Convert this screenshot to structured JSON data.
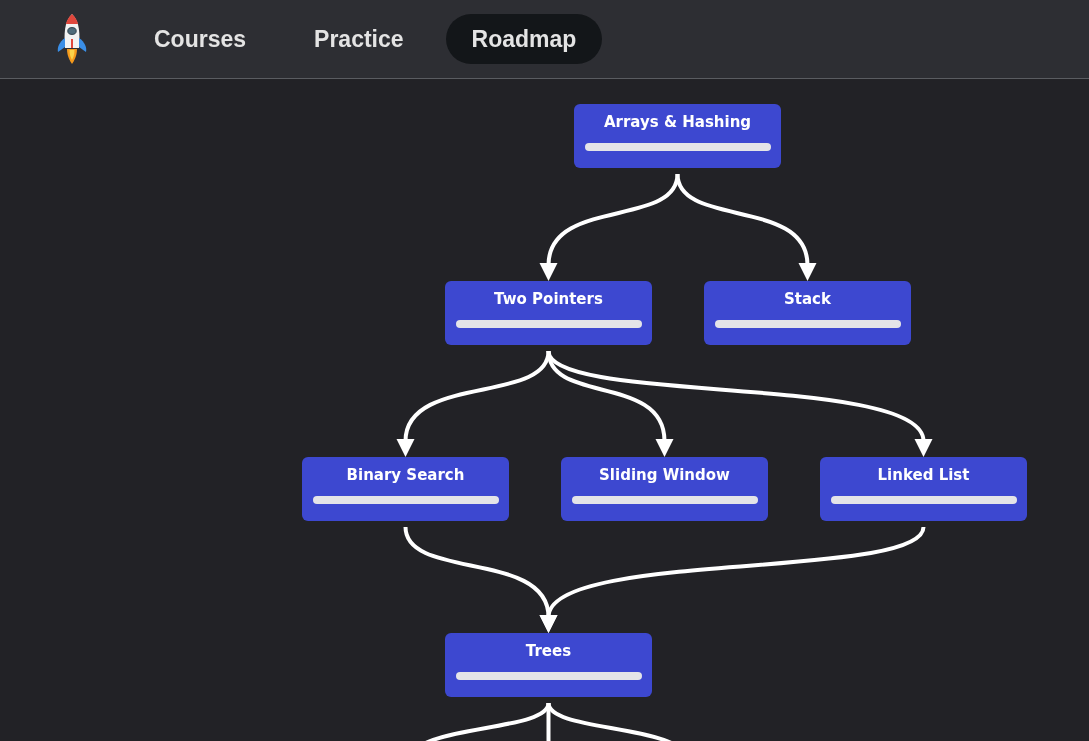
{
  "nav": {
    "tabs": [
      {
        "label": "Courses",
        "selected": false
      },
      {
        "label": "Practice",
        "selected": false
      },
      {
        "label": "Roadmap",
        "selected": true
      }
    ]
  },
  "roadmap": {
    "nodes": [
      {
        "title": "Arrays & Hashing",
        "level": 0
      },
      {
        "title": "Two Pointers",
        "level": 0
      },
      {
        "title": "Stack",
        "level": 0
      },
      {
        "title": "Binary Search",
        "level": 0
      },
      {
        "title": "Sliding Window",
        "level": 0
      },
      {
        "title": "Linked List",
        "level": 0
      },
      {
        "title": "Trees",
        "level": 0
      }
    ]
  }
}
